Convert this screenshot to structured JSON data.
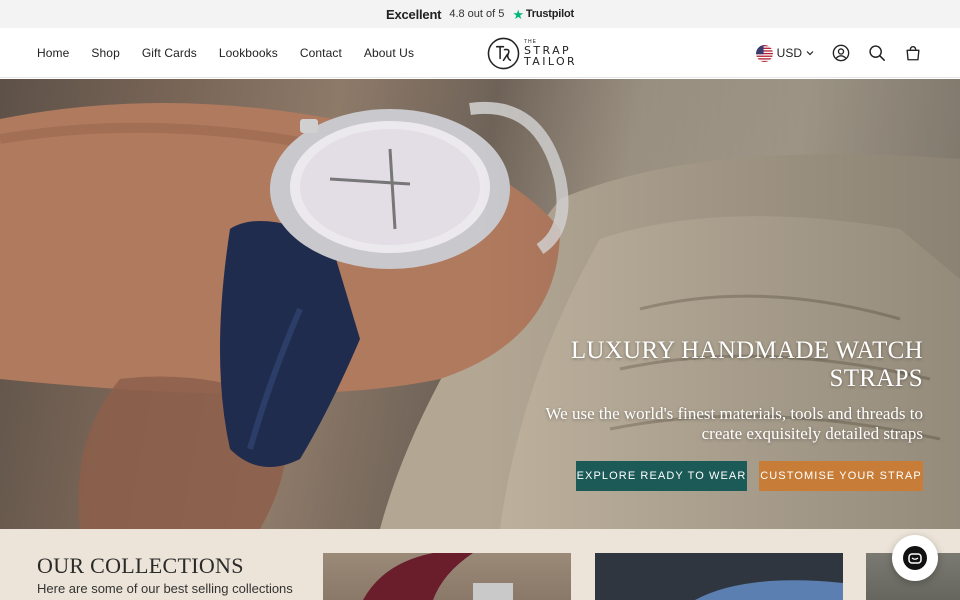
{
  "trustbar": {
    "verdict": "Excellent",
    "rating_text": "4.8 out of 5",
    "provider": "Trustpilot",
    "star_color": "#00b67a"
  },
  "nav": {
    "items": [
      {
        "label": "Home"
      },
      {
        "label": "Shop"
      },
      {
        "label": "Gift Cards"
      },
      {
        "label": "Lookbooks"
      },
      {
        "label": "Contact"
      },
      {
        "label": "About Us"
      }
    ]
  },
  "logo": {
    "the": "THE",
    "line1": "STRAP",
    "line2": "TAILOR"
  },
  "header_right": {
    "currency": "USD",
    "icons": [
      "us-flag-icon",
      "account-icon",
      "search-icon",
      "cart-icon"
    ]
  },
  "hero": {
    "title": "LUXURY HANDMADE WATCH STRAPS",
    "subtitle": "We use the world's finest materials, tools and threads to create exquisitely detailed straps",
    "buttons": [
      {
        "label": "EXPLORE READY TO WEAR",
        "color": "#1b5a57"
      },
      {
        "label": "CUSTOMISE YOUR STRAP",
        "color": "#c77c37"
      }
    ]
  },
  "collections": {
    "title": "OUR COLLECTIONS",
    "subtitle": "Here are some of our best selling collections"
  },
  "colors": {
    "collections_bg": "#ece4d8",
    "trustbar_bg": "#f3f3f3"
  }
}
